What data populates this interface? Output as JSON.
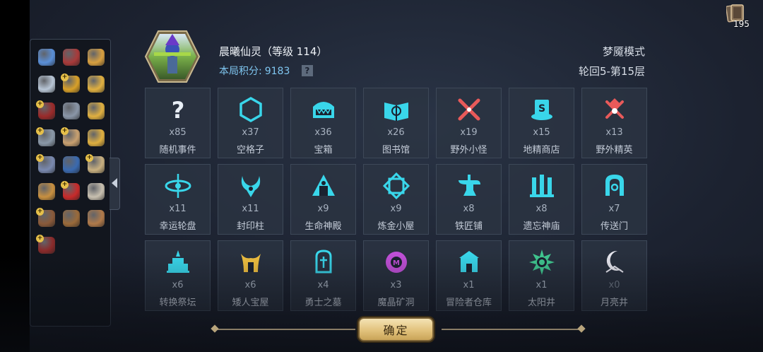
{
  "player": {
    "name": "晨曦仙灵（等级 114）",
    "score_label": "本局积分:",
    "score_value": "9183",
    "help": "?"
  },
  "mode": {
    "name": "梦魇模式",
    "progress": "轮回5-第15层"
  },
  "cards": {
    "count": "195",
    "icon": "cards-icon"
  },
  "inventory": {
    "items": [
      {
        "name": "pendant",
        "color": "#5a8fd8",
        "plus": false
      },
      {
        "name": "scroll-medal",
        "color": "#a83a3a",
        "plus": false
      },
      {
        "name": "potion-sack",
        "color": "#d8a040",
        "plus": false
      },
      {
        "name": "spiky-tag",
        "color": "#b8c6d6",
        "plus": false
      },
      {
        "name": "gold-coin",
        "color": "#d8a028",
        "plus": true
      },
      {
        "name": "gold-gem",
        "color": "#e0b040",
        "plus": false
      },
      {
        "name": "red-book",
        "color": "#9a2a2a",
        "plus": true
      },
      {
        "name": "chest",
        "color": "#8a96a8",
        "plus": false
      },
      {
        "name": "key",
        "color": "#e0b040",
        "plus": false
      },
      {
        "name": "stone-tablet",
        "color": "#8a98a8",
        "plus": true
      },
      {
        "name": "map-scroll",
        "color": "#c8a070",
        "plus": true
      },
      {
        "name": "gold-bars",
        "color": "#e0b040",
        "plus": false
      },
      {
        "name": "card-pack",
        "color": "#7a8ab0",
        "plus": true
      },
      {
        "name": "blue-hat",
        "color": "#3a6ab0",
        "plus": false
      },
      {
        "name": "old-scroll",
        "color": "#c8b080",
        "plus": true
      },
      {
        "name": "anubis",
        "color": "#c89040",
        "plus": false
      },
      {
        "name": "red-potion",
        "color": "#c82a2a",
        "plus": true
      },
      {
        "name": "beast-mask",
        "color": "#c8c0b0",
        "plus": false
      },
      {
        "name": "brown-book",
        "color": "#8a5a3a",
        "plus": true
      },
      {
        "name": "belt",
        "color": "#9a6a3a",
        "plus": false
      },
      {
        "name": "cookie",
        "color": "#b07a4a",
        "plus": false
      },
      {
        "name": "spell-book",
        "color": "#8a2a2a",
        "plus": true
      }
    ]
  },
  "locations": [
    {
      "id": "random-event",
      "count": "x85",
      "label": "随机事件",
      "glyph": "question"
    },
    {
      "id": "empty",
      "count": "x37",
      "label": "空格子",
      "glyph": "hexagon"
    },
    {
      "id": "treasure",
      "count": "x36",
      "label": "宝箱",
      "glyph": "chest"
    },
    {
      "id": "library",
      "count": "x26",
      "label": "图书馆",
      "glyph": "book"
    },
    {
      "id": "wild-monster",
      "count": "x19",
      "label": "野外小怪",
      "glyph": "swords"
    },
    {
      "id": "goblin-shop",
      "count": "x15",
      "label": "地精商店",
      "glyph": "shop"
    },
    {
      "id": "wild-elite",
      "count": "x13",
      "label": "野外精英",
      "glyph": "axe"
    },
    {
      "id": "lucky-wheel",
      "count": "x11",
      "label": "幸运轮盘",
      "glyph": "wheel"
    },
    {
      "id": "seal-pillar",
      "count": "x11",
      "label": "封印柱",
      "glyph": "horns"
    },
    {
      "id": "life-temple",
      "count": "x9",
      "label": "生命神殿",
      "glyph": "temple"
    },
    {
      "id": "alchemy-hut",
      "count": "x9",
      "label": "炼金小屋",
      "glyph": "alchemy"
    },
    {
      "id": "blacksmith",
      "count": "x8",
      "label": "铁匠铺",
      "glyph": "anvil"
    },
    {
      "id": "forgotten-temple",
      "count": "x8",
      "label": "遗忘神庙",
      "glyph": "pillars"
    },
    {
      "id": "portal",
      "count": "x7",
      "label": "传送门",
      "glyph": "portal"
    },
    {
      "id": "convert-altar",
      "count": "x6",
      "label": "转换祭坛",
      "glyph": "altar"
    },
    {
      "id": "dwarf-treasure",
      "count": "x6",
      "label": "矮人宝屋",
      "glyph": "dwarf"
    },
    {
      "id": "warrior-tomb",
      "count": "x4",
      "label": "勇士之墓",
      "glyph": "tomb"
    },
    {
      "id": "crystal-mine",
      "count": "x3",
      "label": "魔晶矿洞",
      "glyph": "crystal"
    },
    {
      "id": "adventurer-storage",
      "count": "x1",
      "label": "冒险者仓库",
      "glyph": "storage"
    },
    {
      "id": "sun-well",
      "count": "x1",
      "label": "太阳井",
      "glyph": "sun"
    },
    {
      "id": "moon-well",
      "count": "x0",
      "label": "月亮井",
      "glyph": "moon"
    }
  ],
  "colors": {
    "accent": "#39d6ea",
    "crystal": "#c050d8",
    "dwarf": "#f0c040",
    "sun": "#40c890",
    "moon": "#e8e8f0"
  },
  "confirm": {
    "label": "确定"
  }
}
